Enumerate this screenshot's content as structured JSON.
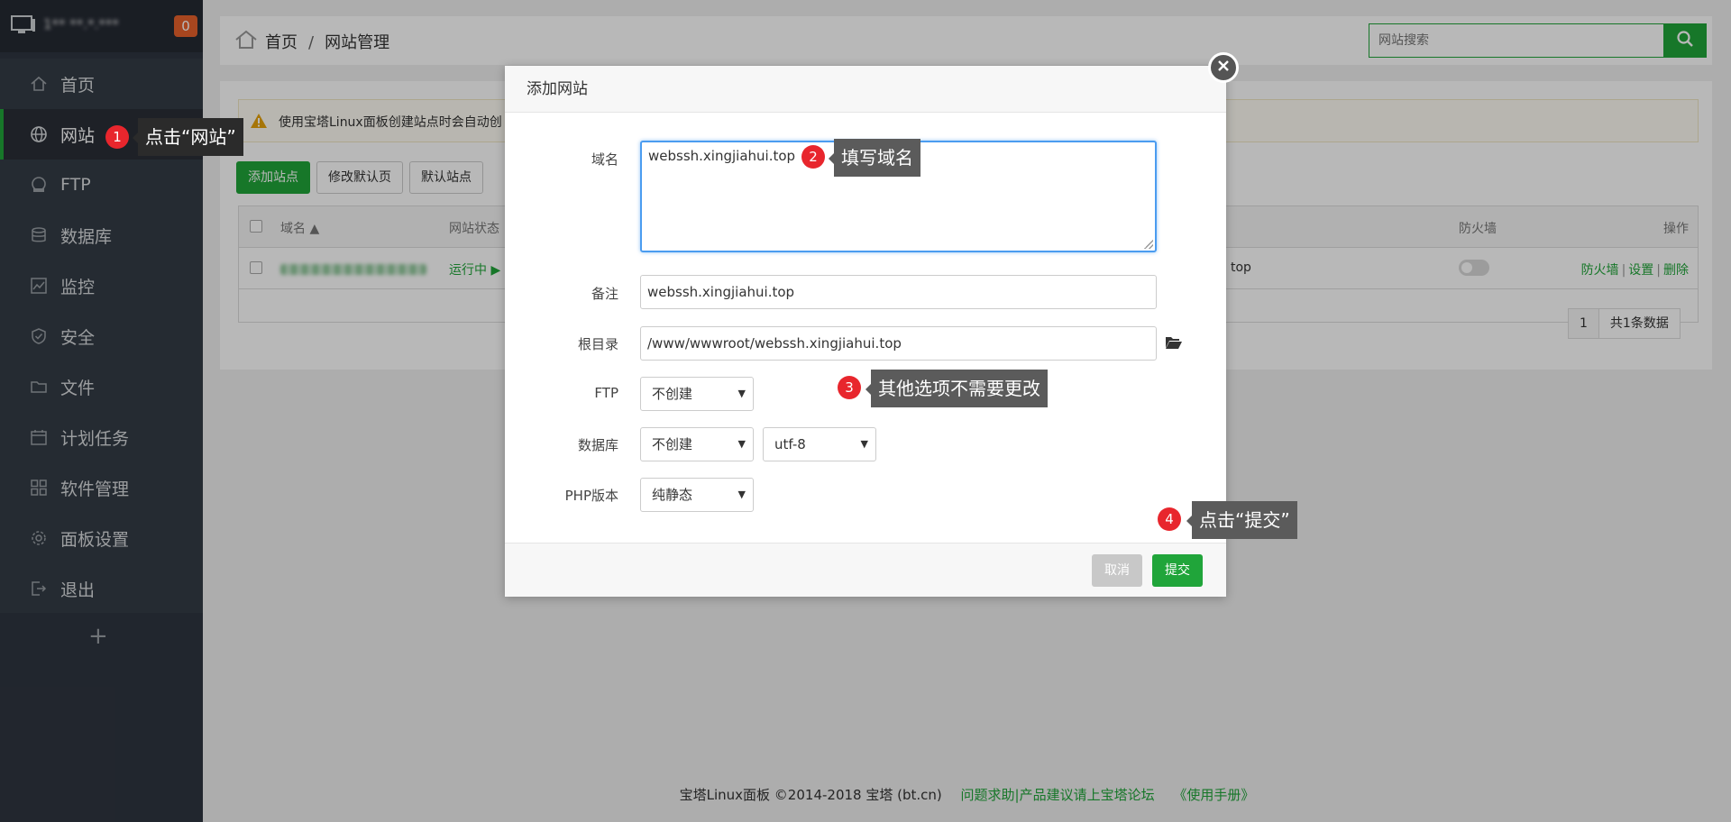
{
  "sidebar": {
    "server_ip": "1** **.*.***",
    "notification_count": "0",
    "items": [
      {
        "label": "首页",
        "icon": "home-icon"
      },
      {
        "label": "网站",
        "icon": "globe-icon"
      },
      {
        "label": "FTP",
        "icon": "ftp-icon"
      },
      {
        "label": "数据库",
        "icon": "database-icon"
      },
      {
        "label": "监控",
        "icon": "monitor-icon"
      },
      {
        "label": "安全",
        "icon": "shield-icon"
      },
      {
        "label": "文件",
        "icon": "folder-icon"
      },
      {
        "label": "计划任务",
        "icon": "calendar-icon"
      },
      {
        "label": "软件管理",
        "icon": "apps-icon"
      },
      {
        "label": "面板设置",
        "icon": "gear-icon"
      },
      {
        "label": "退出",
        "icon": "logout-icon"
      }
    ],
    "add_label": "+"
  },
  "header": {
    "breadcrumb_home": "首页",
    "breadcrumb_sep": "/",
    "breadcrumb_current": "网站管理",
    "search_placeholder": "网站搜索"
  },
  "main": {
    "notice": "使用宝塔Linux面板创建站点时会自动创",
    "buttons": [
      "添加站点",
      "修改默认页",
      "默认站点"
    ],
    "table": {
      "col_domain": "域名",
      "col_status": "网站状态",
      "col_firewall": "防火墙",
      "col_ops": "操作",
      "row_status": "运行中 ▶",
      "row_remark_tail": "top",
      "ops": [
        "防火墙",
        "设置",
        "删除"
      ]
    },
    "pager": {
      "page": "1",
      "total": "共1条数据"
    }
  },
  "footer": {
    "copyright": "宝塔Linux面板 ©2014-2018 宝塔 (bt.cn)",
    "help_link": "问题求助|产品建议请上宝塔论坛",
    "manual_link": "《使用手册》"
  },
  "dialog": {
    "title": "添加网站",
    "domain_label": "域名",
    "domain_value": "webssh.xingjiahui.top",
    "remark_label": "备注",
    "remark_value": "webssh.xingjiahui.top",
    "root_label": "根目录",
    "root_value": "/www/wwwroot/webssh.xingjiahui.top",
    "ftp_label": "FTP",
    "ftp_value": "不创建",
    "db_label": "数据库",
    "db_value": "不创建",
    "db_charset": "utf-8",
    "php_label": "PHP版本",
    "php_value": "纯静态",
    "cancel": "取消",
    "submit": "提交"
  },
  "callouts": [
    {
      "num": "1",
      "text": "点击“网站”"
    },
    {
      "num": "2",
      "text": "填写域名"
    },
    {
      "num": "3",
      "text": "其他选项不需要更改"
    },
    {
      "num": "4",
      "text": "点击“提交”"
    }
  ],
  "colors": {
    "accent": "#20a53a",
    "badge": "#e8612c",
    "callout_num": "#e8262d"
  }
}
